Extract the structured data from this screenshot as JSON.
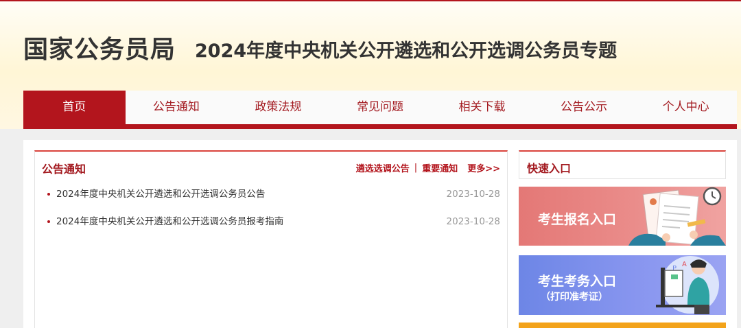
{
  "header": {
    "logo": "国家公务员局",
    "subtitle": "2024年度中央机关公开遴选和公开选调公务员专题"
  },
  "nav": {
    "items": [
      {
        "label": "首页"
      },
      {
        "label": "公告通知"
      },
      {
        "label": "政策法规"
      },
      {
        "label": "常见问题"
      },
      {
        "label": "相关下载"
      },
      {
        "label": "公告公示"
      },
      {
        "label": "个人中心"
      }
    ],
    "active_index": 0
  },
  "notices": {
    "title": "公告通知",
    "link1": "遴选选调公告",
    "separator": "|",
    "link2": "重要通知",
    "more": "更多>>",
    "items": [
      {
        "title": "2024年度中央机关公开遴选和公开选调公务员公告",
        "date": "2023-10-28"
      },
      {
        "title": "2024年度中央机关公开遴选和公开选调公务员报考指南",
        "date": "2023-10-28"
      }
    ]
  },
  "quick": {
    "title": "快速入口",
    "banner1": {
      "label": "考生报名入口"
    },
    "banner2": {
      "label": "考生考务入口",
      "sub": "（打印准考证）"
    }
  },
  "colors": {
    "accent": "#b3151d",
    "header_bg": "#fff6d6",
    "banner1": "#e47876",
    "banner2": "#6d86e6",
    "banner3": "#f3a31a"
  }
}
